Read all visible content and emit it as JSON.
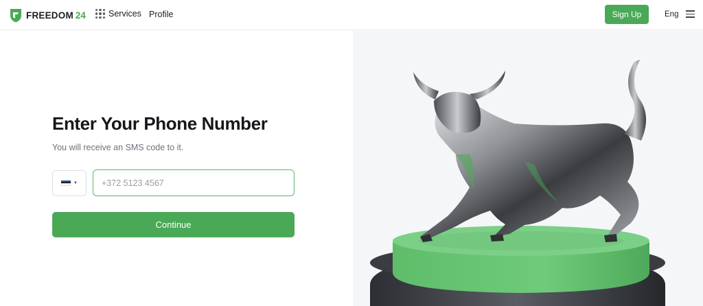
{
  "header": {
    "brand_name": "FREEDOM",
    "brand_number": "24",
    "services_label": "Services",
    "profile_label": "Profile",
    "signup_label": "Sign Up",
    "language": "Eng"
  },
  "form": {
    "title": "Enter Your Phone Number",
    "subtitle": "You will receive an SMS code to it.",
    "country_flag": "flag-icon-estonia",
    "phone_placeholder": "+372 5123 4567",
    "phone_value": "",
    "continue_label": "Continue"
  },
  "colors": {
    "accent": "#4aa956",
    "panel_bg": "#f5f6f8"
  }
}
